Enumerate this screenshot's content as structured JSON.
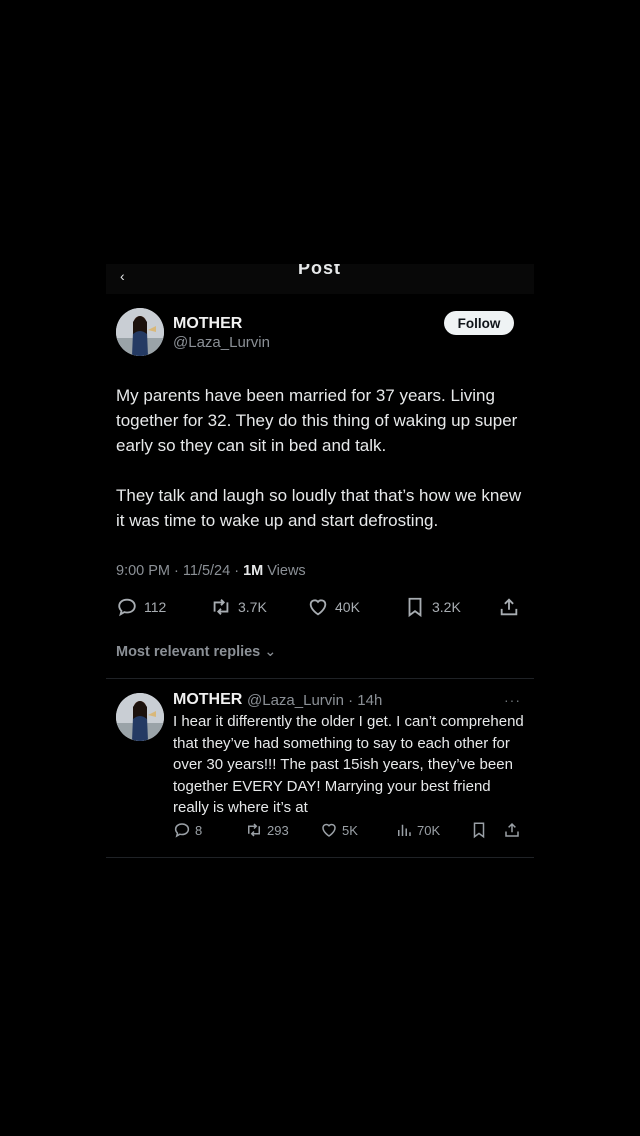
{
  "header": {
    "back_icon": "back-arrow-icon",
    "title": "Post"
  },
  "post": {
    "author_name": "MOTHER",
    "author_handle": "@Laza_Lurvin",
    "follow_label": "Follow",
    "paragraphs": [
      "My parents have been married for 37 years. Living together for 32. They do this thing of waking up super early so they can sit in bed and talk.",
      "They talk and laugh so loudly that that’s how we knew it was time to wake up and start defrosting."
    ],
    "timestamp": "9:00 PM · 11/5/24 · ",
    "views_count": "1M",
    "views_label": " Views",
    "replies": "112",
    "reposts": "3.7K",
    "likes": "40K",
    "bookmarks": "3.2K"
  },
  "replies_filter": {
    "label": "Most relevant replies"
  },
  "reply": {
    "author_name": "MOTHER",
    "author_handle": "@Laza_Lurvin · 14h",
    "more": "···",
    "text": "I hear it differently the older I get. I can’t comprehend that they’ve had something to say to each other for over 30 years!!! The past 15ish years, they’ve been together EVERY DAY! Marrying your best friend really is where it’s at",
    "replies": "8",
    "reposts": "293",
    "likes": "5K",
    "views": "70K"
  }
}
